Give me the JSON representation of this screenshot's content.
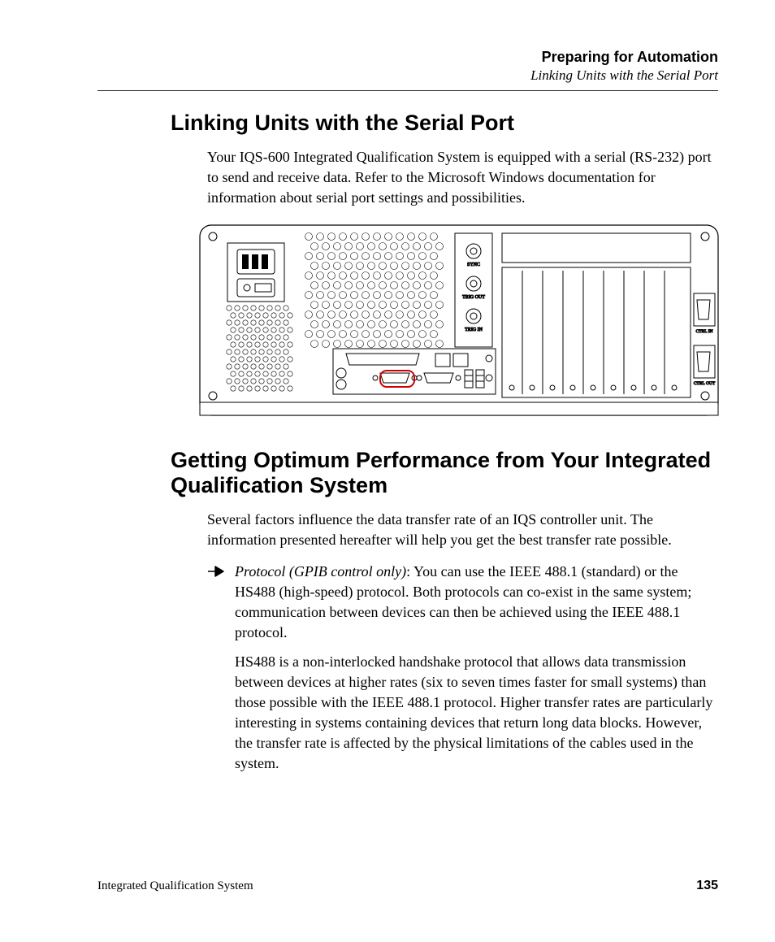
{
  "header": {
    "chapter": "Preparing for Automation",
    "section": "Linking Units with the Serial Port"
  },
  "sections": {
    "s1": {
      "title": "Linking Units with the Serial Port",
      "p1": "Your IQS-600 Integrated Qualification System is equipped with a serial (RS-232) port to send and receive data. Refer to the Microsoft Windows documentation for information about serial port settings and possibilities."
    },
    "s2": {
      "title": "Getting Optimum Performance from Your Integrated Qualification System",
      "p1": "Several factors influence the data transfer rate of an IQS controller unit. The information presented hereafter will help you get the best transfer rate possible.",
      "bullet1_lead": "Protocol (GPIB control only)",
      "bullet1_rest": ": You can use the IEEE 488.1 (standard) or the HS488 (high-speed) protocol. Both protocols can co-exist in the same system; communication between devices can then be achieved using the IEEE 488.1 protocol.",
      "bullet1_follow": "HS488 is a non-interlocked handshake protocol that allows data transmission between devices at higher rates (six to seven times faster for small systems) than those possible with the IEEE 488.1 protocol. Higher transfer rates are particularly interesting in systems containing devices that return long data blocks. However, the transfer rate is affected by the physical limitations of the cables used in the system."
    }
  },
  "figure": {
    "labels": {
      "sync": "SYNC",
      "trig_out": "TRIG OUT",
      "trig_in": "TRIG IN",
      "ctrl_in": "CTRL IN",
      "ctrl_out": "CTRL OUT"
    }
  },
  "footer": {
    "doc": "Integrated Qualification System",
    "page": "135"
  }
}
